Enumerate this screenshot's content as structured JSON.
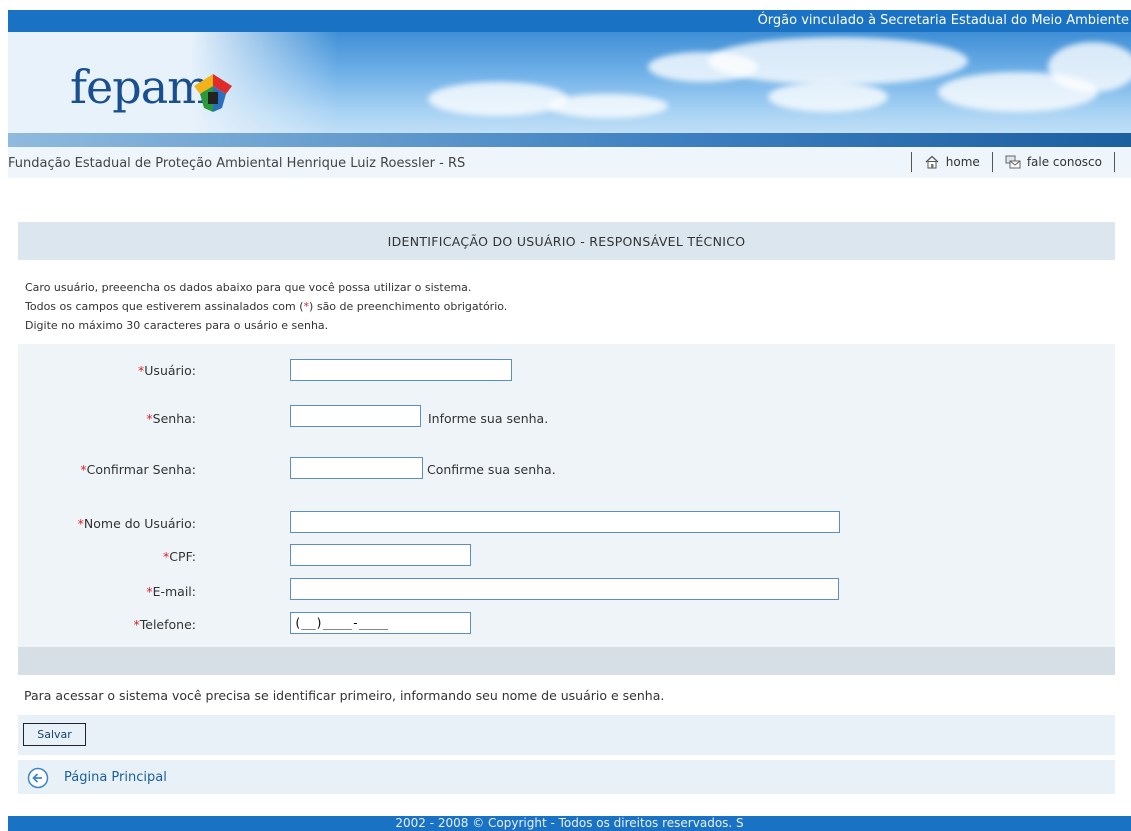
{
  "header": {
    "tagline": "Órgão vinculado à Secretaria Estadual do Meio Ambiente",
    "logo_text": "fepam",
    "org_name": "Fundação Estadual de Proteção Ambiental Henrique Luiz Roessler - RS",
    "nav": {
      "home": "home",
      "contact": "fale conosco"
    }
  },
  "section": {
    "title": "IDENTIFICAÇÃO DO USUÁRIO - RESPONSÁVEL TÉCNICO",
    "intro": {
      "line1": "Caro usuário, preeencha os dados abaixo para que você possa utilizar o sistema.",
      "line2_a": "Todos os campos que estiverem assinalados com (",
      "line2_mark": "*",
      "line2_b": ") são de preenchimento obrigatório.",
      "line3": "Digite no máximo 30 caracteres para o usário e senha."
    }
  },
  "form": {
    "required_mark": "*",
    "usuario": {
      "label": "Usuário:",
      "value": ""
    },
    "senha": {
      "label": "Senha:",
      "value": "",
      "hint": "Informe sua senha."
    },
    "confirmar": {
      "label": "Confirmar Senha:",
      "value": "",
      "hint": "Confirme sua senha."
    },
    "nome": {
      "label": "Nome do Usuário:",
      "value": ""
    },
    "cpf": {
      "label": "CPF:",
      "value": ""
    },
    "email": {
      "label": "E-mail:",
      "value": ""
    },
    "telefone": {
      "label": "Telefone:",
      "value": "(__)____-____"
    }
  },
  "access_note": "Para acessar o sistema você precisa se identificar primeiro, informando seu nome de usuário e senha.",
  "save_label": "Salvar",
  "back_label": "Página Principal",
  "footer": "2002 - 2008 © Copyright - Todos os direitos reservados. S"
}
